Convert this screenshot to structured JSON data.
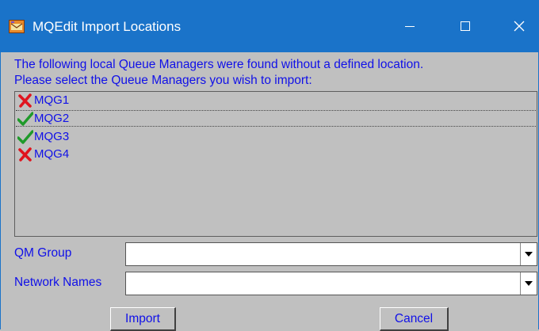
{
  "window": {
    "title": "MQEdit Import Locations",
    "colors": {
      "titlebar": "#1a73c9",
      "text": "#1010e8",
      "background": "#c0c0c0"
    }
  },
  "intro": {
    "line1": "The following local Queue Managers were found without a defined location.",
    "line2": "Please select the Queue Managers you wish to import:"
  },
  "queue_managers": [
    {
      "name": "MQG1",
      "selected": false,
      "icon": "x-mark-icon"
    },
    {
      "name": "MQG2",
      "selected": true,
      "icon": "check-mark-icon"
    },
    {
      "name": "MQG3",
      "selected": true,
      "icon": "check-mark-icon"
    },
    {
      "name": "MQG4",
      "selected": false,
      "icon": "x-mark-icon"
    }
  ],
  "form": {
    "qm_group_label": "QM Group",
    "qm_group_value": "",
    "network_names_label": "Network Names",
    "network_names_value": ""
  },
  "buttons": {
    "import": "Import",
    "cancel": "Cancel"
  }
}
